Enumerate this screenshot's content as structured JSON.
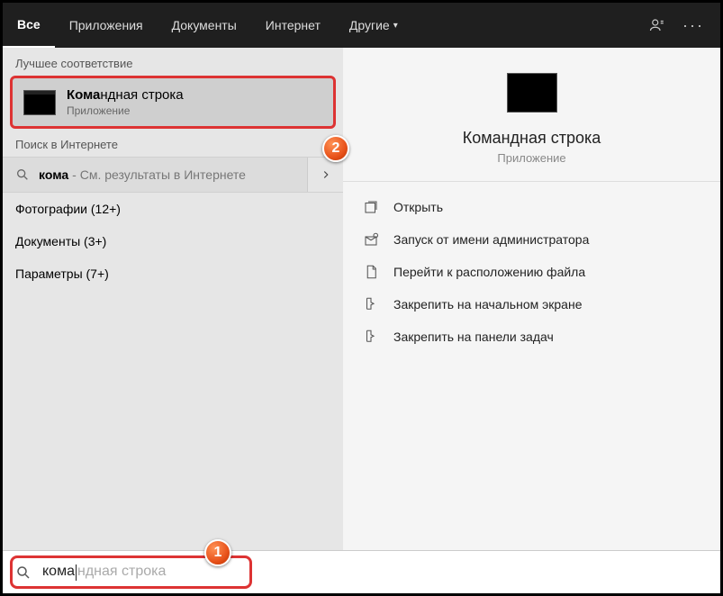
{
  "tabs": {
    "all": "Все",
    "apps": "Приложения",
    "docs": "Документы",
    "web": "Интернет",
    "more": "Другие"
  },
  "left": {
    "best_match_label": "Лучшее соответствие",
    "result": {
      "title_prefix": "Кома",
      "title_rest": "ндная строка",
      "subtitle": "Приложение"
    },
    "web_label": "Поиск в Интернете",
    "web_query": "кома",
    "web_tail": " - См. результаты в Интернете",
    "categories": [
      "Фотографии (12+)",
      "Документы (3+)",
      "Параметры (7+)"
    ]
  },
  "right": {
    "title": "Командная строка",
    "subtitle": "Приложение",
    "actions": {
      "open": "Открыть",
      "admin": "Запуск от имени администратора",
      "location": "Перейти к расположению файла",
      "pin_start": "Закрепить на начальном экране",
      "pin_taskbar": "Закрепить на панели задач"
    }
  },
  "search": {
    "typed": "кома",
    "ghost": "ндная строка"
  },
  "annotations": {
    "b1": "1",
    "b2": "2"
  }
}
